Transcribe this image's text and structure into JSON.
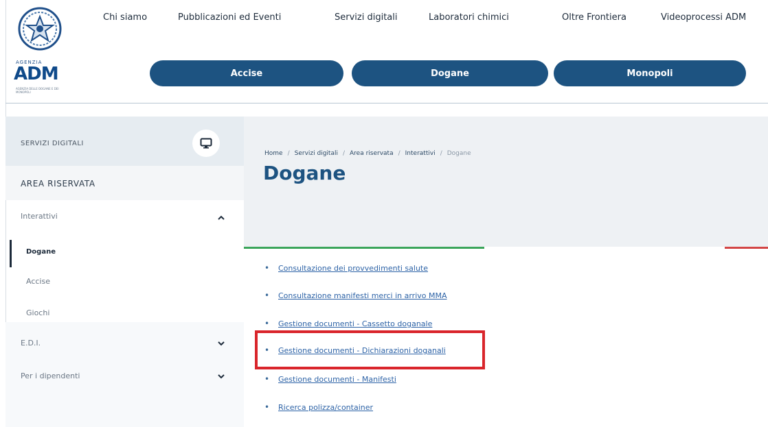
{
  "logo": {
    "agenzia": "AGENZIA",
    "name": "ADM",
    "subtitle": "AGENZIA DELLE DOGANE E DEI MONOPOLI"
  },
  "top_nav": [
    {
      "label": "Chi siamo"
    },
    {
      "label": "Pubblicazioni ed Eventi"
    },
    {
      "label": "Servizi digitali"
    },
    {
      "label": "Laboratori chimici"
    },
    {
      "label": "Oltre Frontiera"
    },
    {
      "label": "Videoprocessi ADM"
    }
  ],
  "main_nav": [
    {
      "label": "Accise"
    },
    {
      "label": "Dogane"
    },
    {
      "label": "Monopoli"
    }
  ],
  "sidebar": {
    "header": "SERVIZI DIGITALI",
    "header_icon": "monitor-icon",
    "area": "AREA RISERVATA",
    "items": [
      {
        "label": "Interattivi",
        "chevron": "chevron-up-icon"
      },
      {
        "label": "Dogane",
        "active": true
      },
      {
        "label": "Accise"
      },
      {
        "label": "Giochi"
      },
      {
        "label": "E.D.I.",
        "chevron": "chevron-down-icon"
      },
      {
        "label": "Per i dipendenti",
        "chevron": "chevron-down-icon"
      }
    ]
  },
  "breadcrumb": [
    {
      "label": "Home"
    },
    {
      "label": "Servizi digitali"
    },
    {
      "label": "Area riservata"
    },
    {
      "label": "Interattivi"
    },
    {
      "label": "Dogane"
    }
  ],
  "page_title": "Dogane",
  "links": [
    {
      "label": "Consultazione dei provvedimenti salute"
    },
    {
      "label": "Consultazione manifesti merci in arrivo MMA"
    },
    {
      "label": "Gestione documenti - Cassetto doganale"
    },
    {
      "label": "Gestione documenti - Dichiarazioni doganali",
      "highlighted": true
    },
    {
      "label": "Gestione documenti - Manifesti"
    },
    {
      "label": "Ricerca polizza/container"
    }
  ],
  "colors": {
    "brand_blue": "#1d5381",
    "link_blue": "#2c62a6",
    "highlight_red": "#d9252b",
    "flag_green": "#3aa55a",
    "flag_red": "#d34545"
  }
}
